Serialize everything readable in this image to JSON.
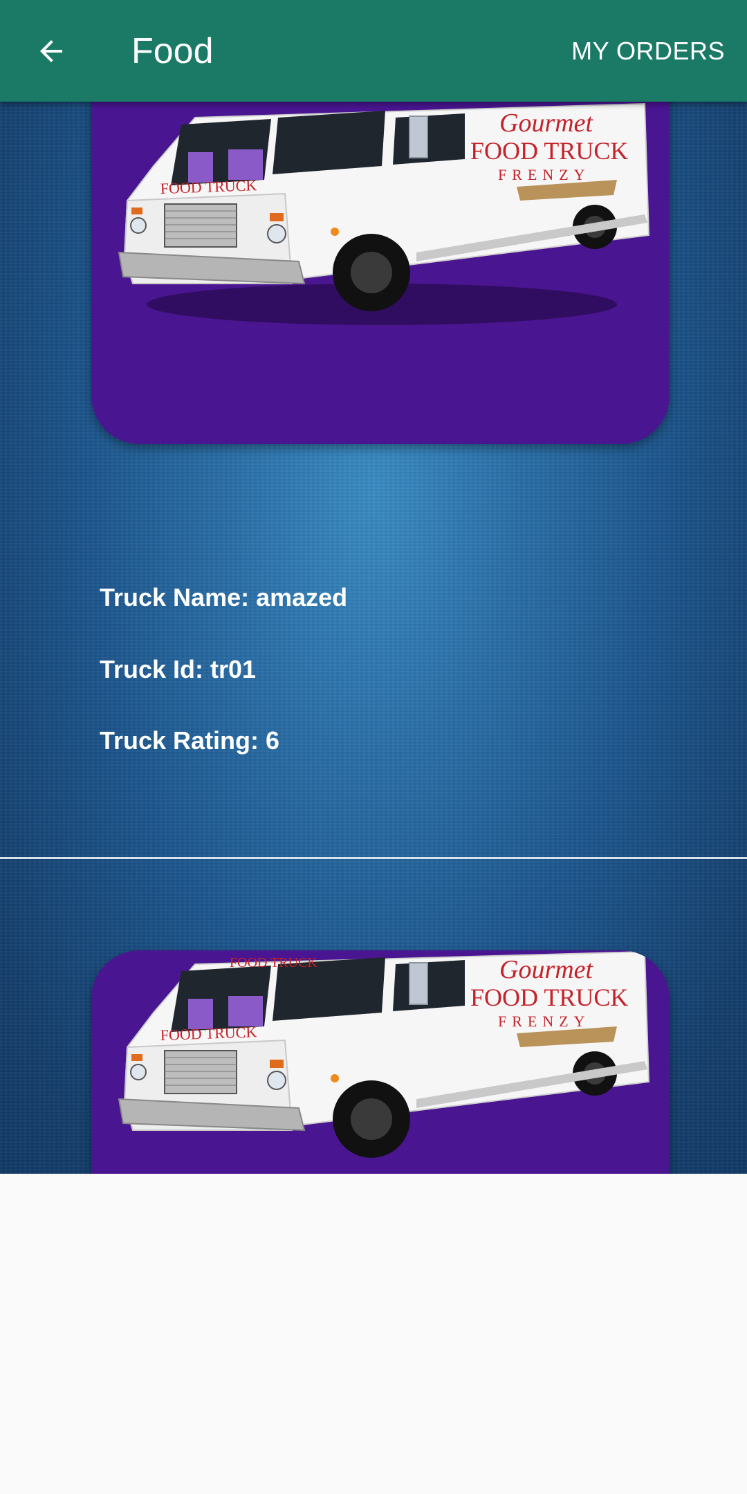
{
  "app_bar": {
    "title": "Food",
    "orders_label": "MY ORDERS",
    "color": "#1a7a66"
  },
  "icons": {
    "back": "arrow-left-icon"
  },
  "truck": {
    "name_line": "Truck Name: amazed",
    "id_line": "Truck Id: tr01",
    "rating_line": "Truck Rating: 6"
  },
  "truck_image": {
    "logo_script": "Gourmet",
    "logo_main": "FOOD TRUCK",
    "logo_sub": "FRENZY",
    "logo_small": "FOOD TRUCK",
    "card_color": "#4a1591"
  }
}
